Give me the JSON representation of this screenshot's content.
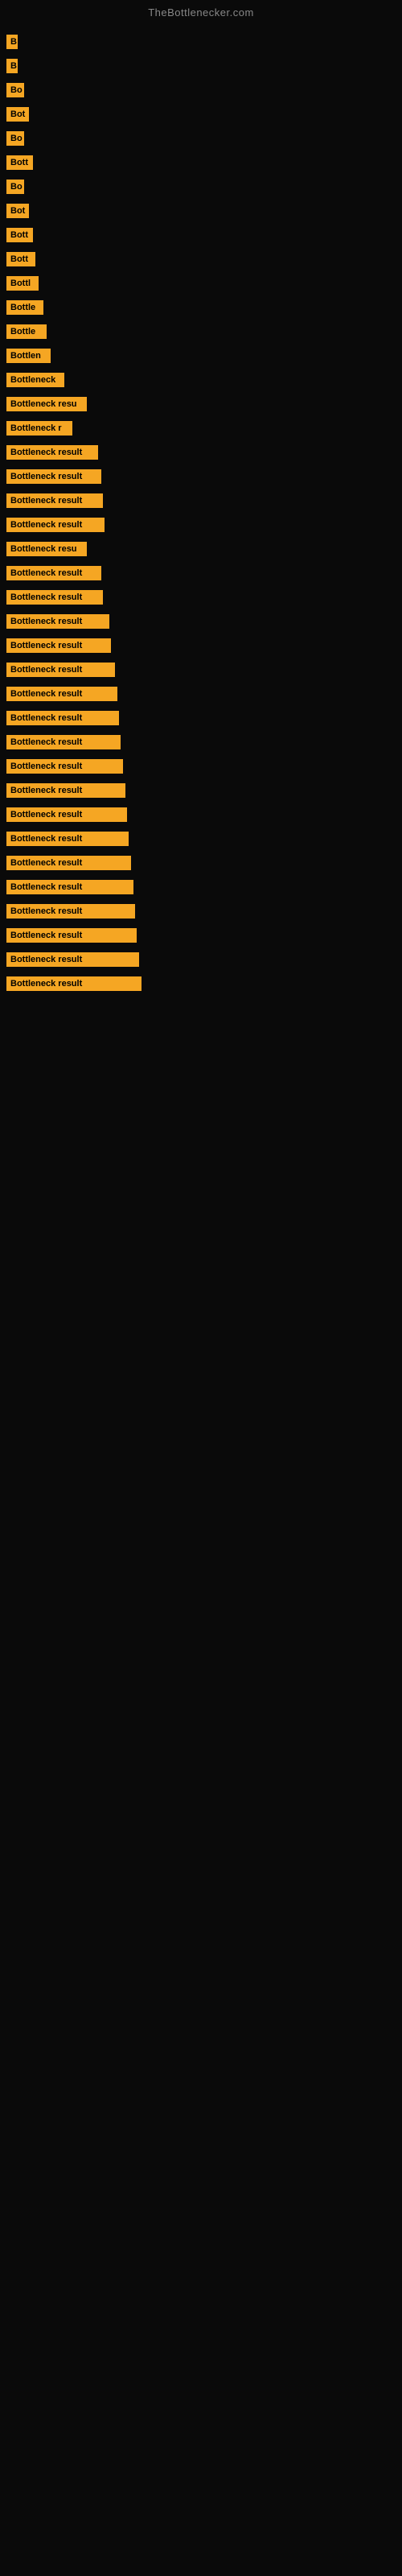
{
  "site": {
    "title": "TheBottlenecker.com"
  },
  "items": [
    {
      "label": "B",
      "width": 14
    },
    {
      "label": "B",
      "width": 14
    },
    {
      "label": "Bo",
      "width": 22
    },
    {
      "label": "Bot",
      "width": 28
    },
    {
      "label": "Bo",
      "width": 22
    },
    {
      "label": "Bott",
      "width": 33
    },
    {
      "label": "Bo",
      "width": 22
    },
    {
      "label": "Bot",
      "width": 28
    },
    {
      "label": "Bott",
      "width": 33
    },
    {
      "label": "Bott",
      "width": 36
    },
    {
      "label": "Bottl",
      "width": 40
    },
    {
      "label": "Bottle",
      "width": 46
    },
    {
      "label": "Bottle",
      "width": 50
    },
    {
      "label": "Bottlen",
      "width": 55
    },
    {
      "label": "Bottleneck",
      "width": 72
    },
    {
      "label": "Bottleneck resu",
      "width": 100
    },
    {
      "label": "Bottleneck r",
      "width": 82
    },
    {
      "label": "Bottleneck result",
      "width": 114
    },
    {
      "label": "Bottleneck result",
      "width": 118
    },
    {
      "label": "Bottleneck result",
      "width": 120
    },
    {
      "label": "Bottleneck result",
      "width": 122
    },
    {
      "label": "Bottleneck resu",
      "width": 100
    },
    {
      "label": "Bottleneck result",
      "width": 118
    },
    {
      "label": "Bottleneck result",
      "width": 120
    },
    {
      "label": "Bottleneck result",
      "width": 128
    },
    {
      "label": "Bottleneck result",
      "width": 130
    },
    {
      "label": "Bottleneck result",
      "width": 135
    },
    {
      "label": "Bottleneck result",
      "width": 138
    },
    {
      "label": "Bottleneck result",
      "width": 140
    },
    {
      "label": "Bottleneck result",
      "width": 142
    },
    {
      "label": "Bottleneck result",
      "width": 145
    },
    {
      "label": "Bottleneck result",
      "width": 148
    },
    {
      "label": "Bottleneck result",
      "width": 150
    },
    {
      "label": "Bottleneck result",
      "width": 152
    },
    {
      "label": "Bottleneck result",
      "width": 155
    },
    {
      "label": "Bottleneck result",
      "width": 158
    },
    {
      "label": "Bottleneck result",
      "width": 160
    },
    {
      "label": "Bottleneck result",
      "width": 162
    },
    {
      "label": "Bottleneck result",
      "width": 165
    },
    {
      "label": "Bottleneck result",
      "width": 168
    }
  ]
}
